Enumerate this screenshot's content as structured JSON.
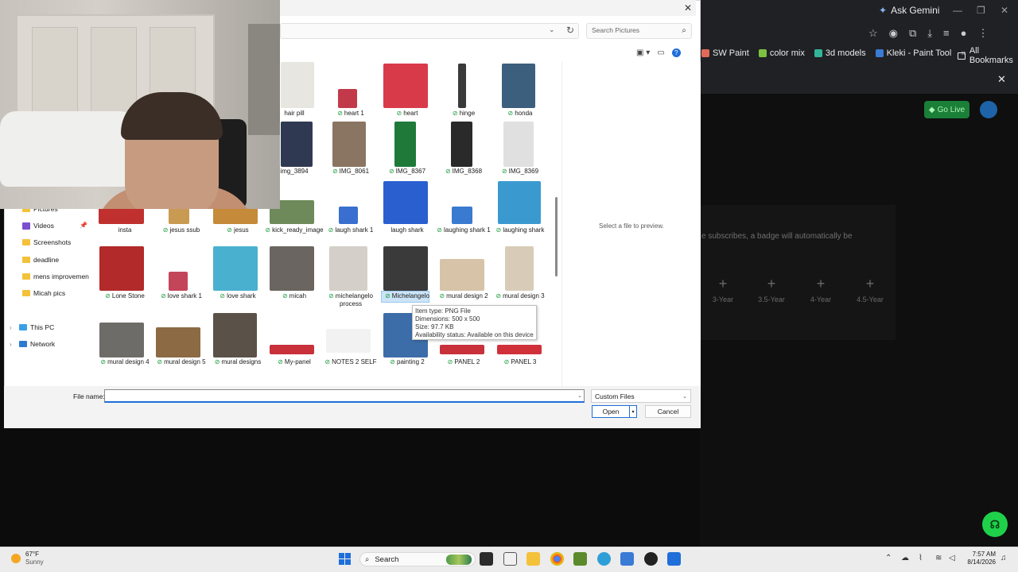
{
  "browser": {
    "ask_gemini": "Ask Gemini",
    "bookmarks": [
      {
        "label": "SW Paint",
        "color": "#e06b5a"
      },
      {
        "label": "color mix",
        "color": "#7cc242"
      },
      {
        "label": "3d models",
        "color": "#33b59a"
      },
      {
        "label": "Kleki - Paint Tool",
        "color": "#3a7bd5"
      }
    ],
    "all_bookmarks": "All Bookmarks",
    "go_live": "Go Live",
    "badge_info": "e subscribes, a badge will automatically be",
    "badges": [
      "3-Year",
      "3.5-Year",
      "4-Year",
      "4.5-Year"
    ]
  },
  "dialog": {
    "search_placeholder": "Search Pictures",
    "preview_text": "Select a file to preview.",
    "nav": [
      {
        "label": "Pictures",
        "icon": "folder"
      },
      {
        "label": "Videos",
        "icon": "videos"
      },
      {
        "label": "Screenshots",
        "icon": "folder"
      },
      {
        "label": "deadline",
        "icon": "folder"
      },
      {
        "label": "mens improvemen",
        "icon": "folder"
      },
      {
        "label": "Micah pics",
        "icon": "folder"
      },
      {
        "label": "This PC",
        "icon": "pc"
      },
      {
        "label": "Network",
        "icon": "network"
      }
    ],
    "files": [
      {
        "name": "hair pill",
        "thumb": "#e8e6e0",
        "synced": false
      },
      {
        "name": "heart 1",
        "thumb": "#c23a4a",
        "synced": true
      },
      {
        "name": "heart",
        "thumb": "#d83a4a",
        "synced": true
      },
      {
        "name": "hinge",
        "thumb": "#3a3a3a",
        "synced": true
      },
      {
        "name": "honda",
        "thumb": "#3c5f7d",
        "synced": true
      },
      {
        "name": "img_3894",
        "thumb": "#2f3a52",
        "synced": false
      },
      {
        "name": "IMG_8061",
        "thumb": "#8a7462",
        "synced": true
      },
      {
        "name": "IMG_8367",
        "thumb": "#1f7a3a",
        "synced": true
      },
      {
        "name": "IMG_8368",
        "thumb": "#2a2a2a",
        "synced": true
      },
      {
        "name": "IMG_8369",
        "thumb": "#e0e0e0",
        "synced": true
      },
      {
        "name": "insta",
        "thumb": "#c0302f",
        "synced": false
      },
      {
        "name": "jesus ssub",
        "thumb": "#c99a52",
        "synced": true
      },
      {
        "name": "jesus",
        "thumb": "#c58a3a",
        "synced": true
      },
      {
        "name": "kick_ready_image",
        "thumb": "#6f8a5a",
        "synced": true
      },
      {
        "name": "laugh shark 1",
        "thumb": "#3a6fcf",
        "synced": true
      },
      {
        "name": "laugh shark",
        "thumb": "#2a5fd0",
        "synced": false
      },
      {
        "name": "laughing shark 1",
        "thumb": "#3a7ad0",
        "synced": true
      },
      {
        "name": "laughing shark",
        "thumb": "#3a9ad0",
        "synced": true
      },
      {
        "name": "Lone Stone",
        "thumb": "#b22a2a",
        "synced": true
      },
      {
        "name": "love shark 1",
        "thumb": "#c3455a",
        "synced": true
      },
      {
        "name": "love shark",
        "thumb": "#4ab0d0",
        "synced": true
      },
      {
        "name": "micah",
        "thumb": "#6a6560",
        "synced": true
      },
      {
        "name": "michelangelo process",
        "thumb": "#d4cfc8",
        "synced": true
      },
      {
        "name": "Michelangelo",
        "thumb": "#3a3a3a",
        "synced": true
      },
      {
        "name": "mural design 2",
        "thumb": "#d6c3a8",
        "synced": true
      },
      {
        "name": "mural design 3",
        "thumb": "#d8ccb8",
        "synced": true
      },
      {
        "name": "mural design 4",
        "thumb": "#6e6c68",
        "synced": true
      },
      {
        "name": "mural design 5",
        "thumb": "#8c6a44",
        "synced": true
      },
      {
        "name": "mural designs",
        "thumb": "#5a5248",
        "synced": true
      },
      {
        "name": "My-panel",
        "thumb": "#c8303a",
        "synced": true
      },
      {
        "name": "NOTES 2 SELF",
        "thumb": "#f2f2f2",
        "synced": true
      },
      {
        "name": "painting 2",
        "thumb": "#3c6da8",
        "synced": true
      },
      {
        "name": "PANEL 2",
        "thumb": "#c8303a",
        "synced": true
      },
      {
        "name": "PANEL 3",
        "thumb": "#d0303a",
        "synced": true
      }
    ],
    "tooltip": {
      "type": "Item type: PNG File",
      "dimensions": "Dimensions: 500 x 500",
      "size": "Size: 97.7 KB",
      "availability": "Availability status: Available on this device"
    },
    "file_name_label": "File name:",
    "file_name_value": "",
    "filter": "Custom Files",
    "open": "Open",
    "cancel": "Cancel"
  },
  "taskbar": {
    "temp": "67°F",
    "condition": "Sunny",
    "search": "Search",
    "time": "7:57 AM",
    "date": "8/14/2026"
  }
}
